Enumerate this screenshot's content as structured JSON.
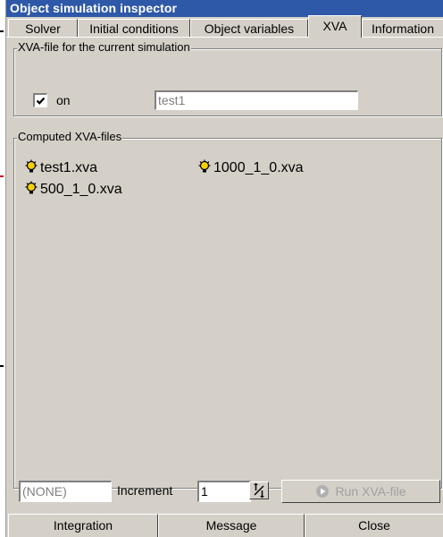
{
  "window": {
    "title": "Object simulation inspector"
  },
  "tabs": [
    {
      "label": "Solver",
      "active": false
    },
    {
      "label": "Initial conditions",
      "active": false
    },
    {
      "label": "Object variables",
      "active": false
    },
    {
      "label": "XVA",
      "active": true
    },
    {
      "label": "Information",
      "active": false
    }
  ],
  "xva_group": {
    "legend": "XVA-file for the current simulation",
    "checkbox_label": "on",
    "checkbox_checked": true,
    "filename_value": "test1"
  },
  "computed_group": {
    "legend": "Computed XVA-files",
    "files": [
      {
        "name": "test1.xva",
        "icon": "bulb-icon"
      },
      {
        "name": "1000_1_0.xva",
        "icon": "bulb-icon"
      },
      {
        "name": "500_1_0.xva",
        "icon": "bulb-icon"
      }
    ]
  },
  "controls": {
    "selection_value": "(NONE)",
    "increment_label": "Increment",
    "increment_value": "1",
    "run_label": "Run XVA-file"
  },
  "bottom_buttons": {
    "integration": "Integration",
    "message": "Message",
    "close": "Close"
  },
  "colors": {
    "titlebar": "#2e58a8",
    "face": "#d4d0c8",
    "bulb": "#f4d000"
  }
}
